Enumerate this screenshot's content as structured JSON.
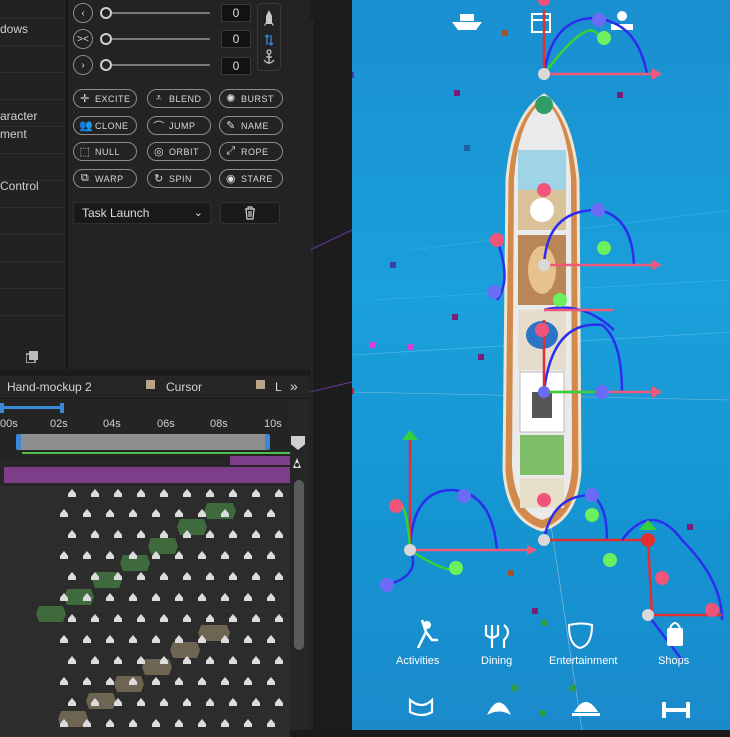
{
  "menu": {
    "items": [
      "dows",
      "aracter",
      "ment",
      "Control"
    ]
  },
  "tools": {
    "sliders": [
      {
        "icon": "chevron-left-icon",
        "value": "0"
      },
      {
        "icon": "collapse-icon",
        "value": "0"
      },
      {
        "icon": "chevron-right-icon",
        "value": "0"
      }
    ],
    "buttons": [
      "EXCITE",
      "BLEND",
      "BURST",
      "CLONE",
      "JUMP",
      "NAME",
      "NULL",
      "ORBIT",
      "ROPE",
      "WARP",
      "SPIN",
      "STARE"
    ],
    "task_dropdown": "Task Launch"
  },
  "timeline": {
    "tabs": [
      "Hand-mockup 2",
      "Cursor",
      "L"
    ],
    "ticks": [
      "00s",
      "02s",
      "04s",
      "06s",
      "08s",
      "10s"
    ],
    "expand_icon": "»"
  },
  "app_labels": [
    "Activities",
    "Dining",
    "Entertainment",
    "Shops"
  ],
  "colors": {
    "ocean": "#1a9ad8",
    "handle_red": "#f0547a",
    "handle_green": "#6cf05e",
    "handle_blue": "#6b6cf5",
    "workarea_blue": "#3a88d8",
    "purple_layer": "#7e3d8a"
  }
}
